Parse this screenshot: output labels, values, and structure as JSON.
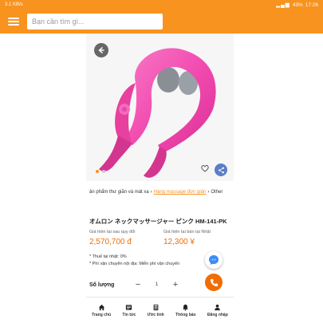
{
  "status_bar": {
    "left_text": "3.1 KB/s",
    "battery_percent": "43%",
    "time": "17:26"
  },
  "header": {
    "search_placeholder": "Bạn cần tìm gì...",
    "accent_color": "#f7931e"
  },
  "gallery": {
    "slide_count": 2,
    "active_slide": 1,
    "product_color": "#f24bb0"
  },
  "breadcrumb": {
    "prefix": "ản phẩm thư giãn và mát xa",
    "link": "Hàng massage đơn giản",
    "suffix": "Other"
  },
  "product": {
    "title": "オムロン ネックマッサージャー ピンク HM-141-PK",
    "price_vn_label": "Giá hiện tại sau quy đổi",
    "price_vn": "2,570,700 đ",
    "price_jp_label": "Giá hiện tại bán tại Nhật",
    "price_jp": "12,300 ¥",
    "tax_note": "* Thuế tại nhật: 0%",
    "shipping_note": "* Phí vận chuyển nội địa: Miễn phí vận chuyển",
    "price_color": "#f06d06"
  },
  "quantity": {
    "label": "Số lượng",
    "value": "1",
    "minus": "−",
    "plus": "+"
  },
  "bottom_nav": {
    "items": [
      {
        "label": "Trang chủ",
        "icon": "home-icon"
      },
      {
        "label": "Tin tức",
        "icon": "news-icon"
      },
      {
        "label": "Ước tính",
        "icon": "calculator-icon"
      },
      {
        "label": "Thông báo",
        "icon": "bell-icon"
      },
      {
        "label": "Đăng nhập",
        "icon": "user-icon"
      }
    ]
  }
}
